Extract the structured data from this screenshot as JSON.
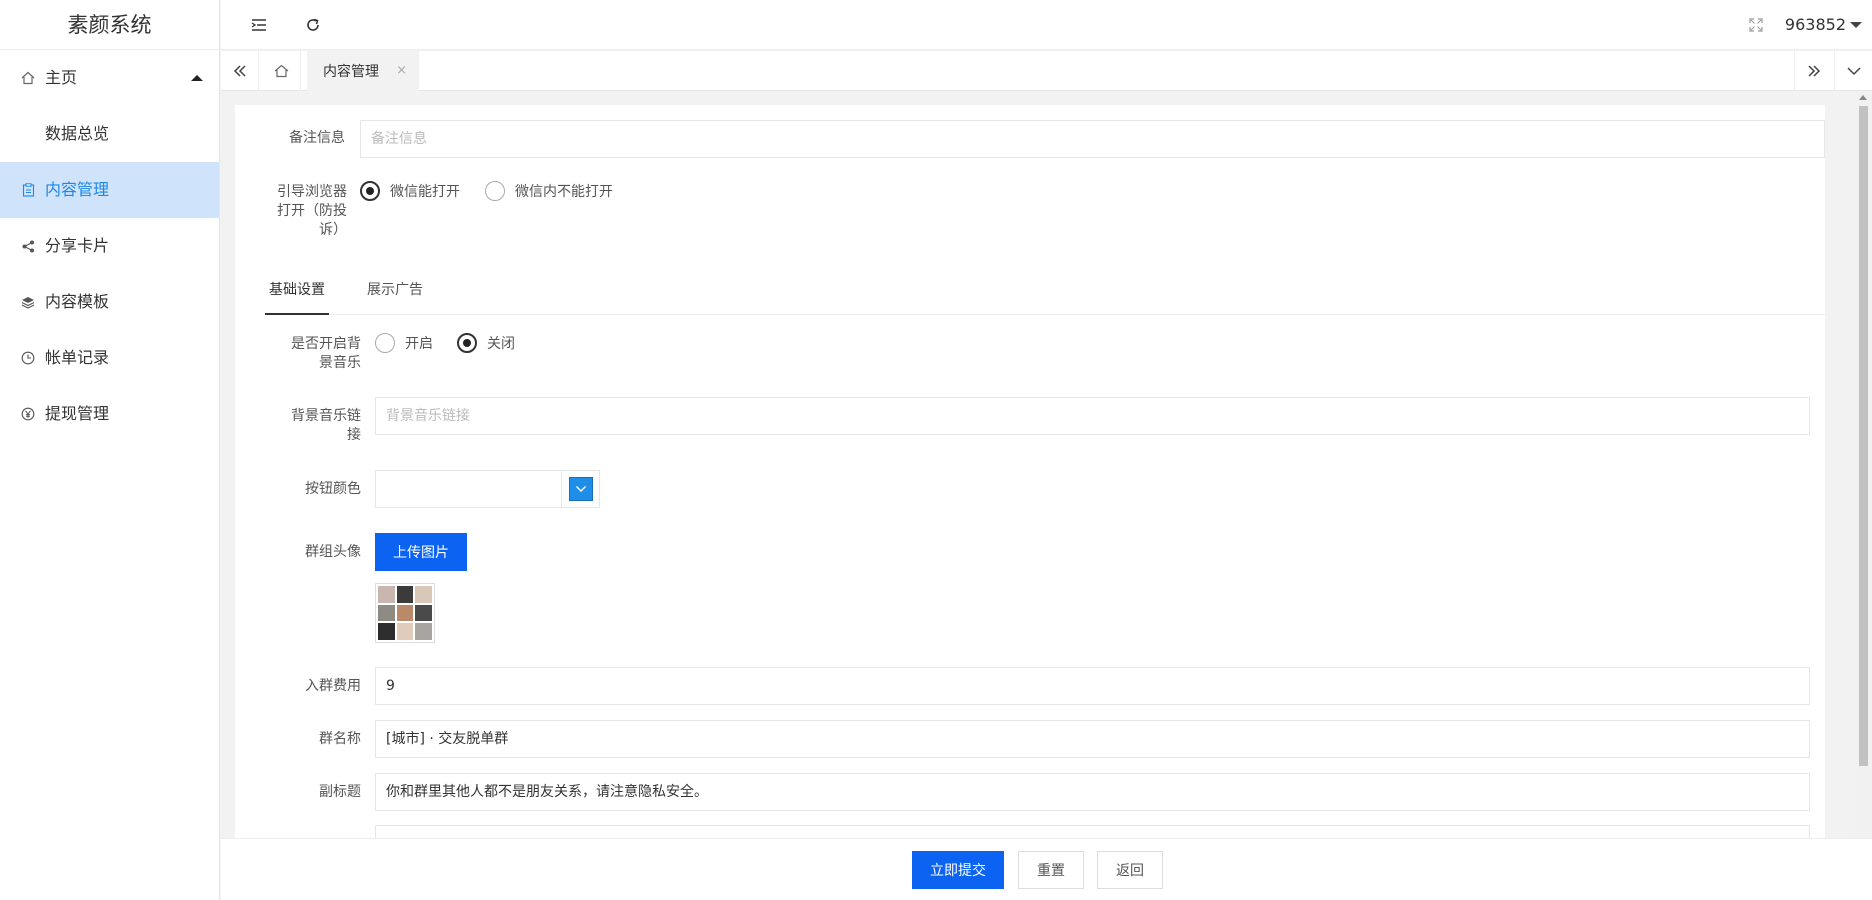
{
  "app": {
    "title": "素颜系统"
  },
  "sidebar": {
    "items": [
      {
        "label": "主页",
        "icon": "home-icon"
      },
      {
        "label": "数据总览"
      },
      {
        "label": "内容管理",
        "icon": "clipboard-icon",
        "active": true
      },
      {
        "label": "分享卡片",
        "icon": "share-icon"
      },
      {
        "label": "内容模板",
        "icon": "layers-icon"
      },
      {
        "label": "帐单记录",
        "icon": "clock-icon"
      },
      {
        "label": "提现管理",
        "icon": "yen-icon"
      }
    ]
  },
  "header": {
    "username": "963852"
  },
  "tabsbar": {
    "current_tab": "内容管理",
    "close_glyph": "×"
  },
  "form": {
    "remark": {
      "label": "备注信息",
      "placeholder": "备注信息"
    },
    "browser_guide": {
      "label": "引导浏览器打开（防投诉）",
      "options": [
        "微信能打开",
        "微信内不能打开"
      ],
      "selected": "微信能打开"
    },
    "tabs": [
      "基础设置",
      "展示广告"
    ],
    "active_tab": "基础设置",
    "bg_music": {
      "label": "是否开启背景音乐",
      "options": [
        "开启",
        "关闭"
      ],
      "selected": "关闭"
    },
    "bg_music_link": {
      "label": "背景音乐链接",
      "placeholder": "背景音乐链接"
    },
    "button_color": {
      "label": "按钮颜色",
      "value": ""
    },
    "group_avatar": {
      "label": "群组头像",
      "upload_label": "上传图片"
    },
    "join_fee": {
      "label": "入群费用",
      "value": "9"
    },
    "group_name": {
      "label": "群名称",
      "value": "[城市] · 交友脱单群"
    },
    "subtitle": {
      "label": "副标题",
      "value": "你和群里其他人都不是朋友关系，请注意隐私安全。"
    }
  },
  "footer": {
    "submit": "立即提交",
    "reset": "重置",
    "back": "返回"
  },
  "colors": {
    "primary": "#0c63f2",
    "active_bg": "#cfe3fb",
    "active_text": "#1e88e5",
    "picker": "#1e8ee8"
  }
}
